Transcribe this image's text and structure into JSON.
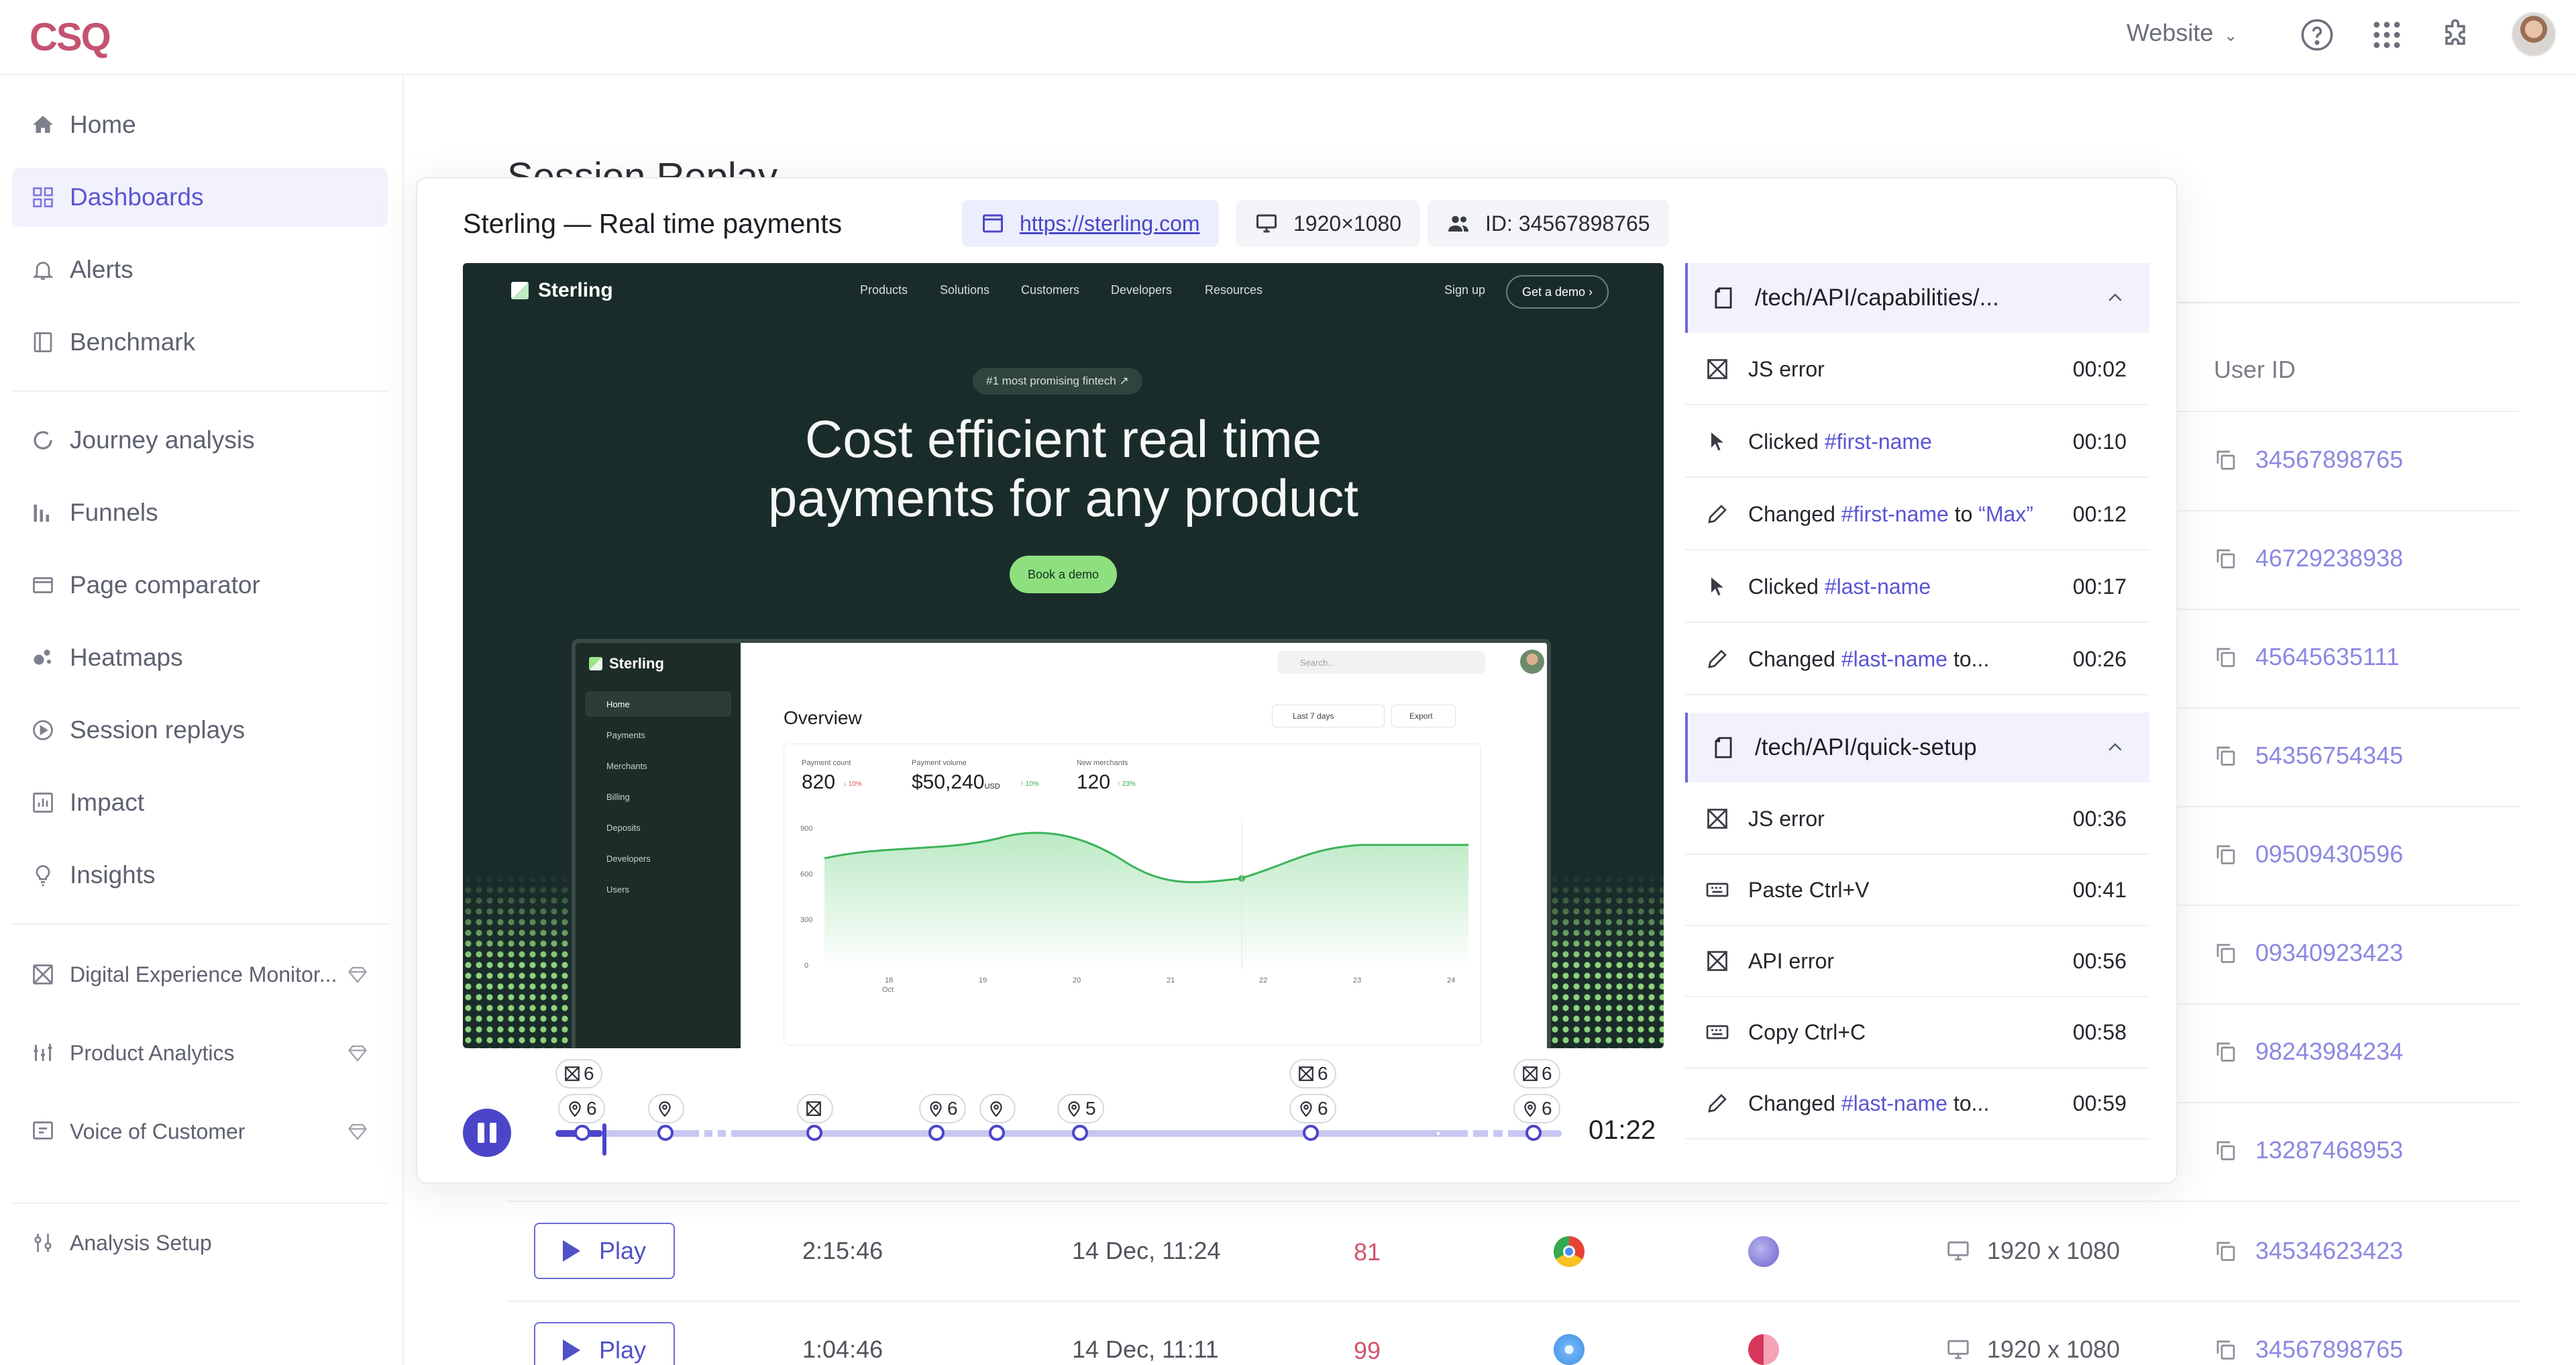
{
  "topbar": {
    "logo": "CSQ",
    "website_select": "Website"
  },
  "sidebar": {
    "items": [
      {
        "label": "Home",
        "icon": "home-icon"
      },
      {
        "label": "Dashboards",
        "icon": "grid-icon",
        "active": true
      },
      {
        "label": "Alerts",
        "icon": "bell-icon"
      },
      {
        "label": "Benchmark",
        "icon": "bookmark-icon"
      },
      {
        "label": "Journey analysis",
        "icon": "journey-icon"
      },
      {
        "label": "Funnels",
        "icon": "funnel-icon"
      },
      {
        "label": "Page comparator",
        "icon": "window-icon"
      },
      {
        "label": "Heatmaps",
        "icon": "heatmap-icon"
      },
      {
        "label": "Session replays",
        "icon": "play-circle-icon"
      },
      {
        "label": "Impact",
        "icon": "impact-icon"
      },
      {
        "label": "Insights",
        "icon": "lightbulb-icon"
      }
    ],
    "products": [
      {
        "label": "Digital Experience Monitor...",
        "icon": "monitor-icon"
      },
      {
        "label": "Product Analytics",
        "icon": "analytics-icon"
      },
      {
        "label": "Voice of Customer",
        "icon": "voice-icon"
      }
    ],
    "setup": {
      "label": "Analysis Setup",
      "icon": "sliders-icon"
    }
  },
  "background": {
    "page_title": "Session Replay",
    "column_user_id": "User ID",
    "user_ids": [
      "34567898765",
      "46729238938",
      "45645635111",
      "54356754345",
      "09509430596",
      "09340923423",
      "98243984234",
      "13287468953"
    ],
    "rows": [
      {
        "play": "Play",
        "duration": "2:15:46",
        "date": "14 Dec, 11:24",
        "score": "81",
        "browser": "chrome",
        "resolution": "1920 x 1080",
        "user_id": "34534623423"
      },
      {
        "play": "Play",
        "duration": "1:04:46",
        "date": "14 Dec, 11:11",
        "score": "99",
        "browser": "safari",
        "resolution": "1920 x 1080",
        "user_id": "34567898765"
      }
    ]
  },
  "modal": {
    "title": "Sterling — Real time payments",
    "url": "https://sterling.com",
    "resolution": "1920×1080",
    "id_label": "ID: 34567898765",
    "time_readout": "01:22"
  },
  "replay": {
    "brand": "Sterling",
    "nav": [
      "Products",
      "Solutions",
      "Customers",
      "Developers",
      "Resources"
    ],
    "signup": "Sign up",
    "get_demo": "Get a demo",
    "pill": "#1 most promising fintech ↗",
    "hero_line1": "Cost efficient real time",
    "hero_line2": "payments for any product",
    "cta": "Book a demo",
    "mock": {
      "brand": "Sterling",
      "menu": [
        "Home",
        "Payments",
        "Merchants",
        "Billing",
        "Deposits",
        "Developers",
        "Users"
      ],
      "search": "Search...",
      "overview": "Overview",
      "range": "Last 7 days",
      "export": "Export",
      "kpis": [
        {
          "label": "Payment count",
          "value": "820",
          "delta": "↓ 10%",
          "dir": "neg"
        },
        {
          "label": "Payment volume",
          "value": "$50,240",
          "unit": "USD",
          "delta": "↑ 10%",
          "dir": "pos"
        },
        {
          "label": "New merchants",
          "value": "120",
          "delta": "↑ 23%",
          "dir": "pos"
        }
      ],
      "y_ticks": [
        "900",
        "600",
        "300",
        "0"
      ],
      "x_ticks": [
        "18",
        "19",
        "20",
        "21",
        "22",
        "23",
        "24"
      ],
      "x_month": "Oct"
    }
  },
  "timeline_badges": [
    "6",
    "6",
    "6",
    "5",
    "6",
    "6",
    "6",
    "6"
  ],
  "events": {
    "group1": {
      "path": "/tech/API/capabilities/...",
      "rows": [
        {
          "icon": "error-icon",
          "text": "JS error",
          "time": "00:02"
        },
        {
          "icon": "cursor-icon",
          "pre": "Clicked ",
          "hl": "#first-name",
          "post": "",
          "time": "00:10"
        },
        {
          "icon": "pencil-icon",
          "pre": "Changed ",
          "hl": "#first-name",
          "post": " to ",
          "hl2": "“Max”",
          "time": "00:12"
        },
        {
          "icon": "cursor-icon",
          "pre": "Clicked ",
          "hl": "#last-name",
          "post": "",
          "time": "00:17"
        },
        {
          "icon": "pencil-icon",
          "pre": "Changed ",
          "hl": "#last-name",
          "post": " to...",
          "time": "00:26"
        }
      ]
    },
    "group2": {
      "path": "/tech/API/quick-setup",
      "rows": [
        {
          "icon": "error-icon",
          "text": "JS error",
          "time": "00:36"
        },
        {
          "icon": "keyboard-icon",
          "text": "Paste Ctrl+V",
          "time": "00:41"
        },
        {
          "icon": "error-icon",
          "text": "API error",
          "time": "00:56"
        },
        {
          "icon": "keyboard-icon",
          "text": "Copy Ctrl+C",
          "time": "00:58"
        },
        {
          "icon": "pencil-icon",
          "pre": "Changed ",
          "hl": "#last-name",
          "post": " to...",
          "time": "00:59"
        }
      ]
    }
  },
  "colors": {
    "accent": "#4b46c9",
    "accent_light": "#f1f2fb",
    "link": "#8b88e2",
    "score_red": "#d1546b",
    "video_bg": "#1a2c2a",
    "cta_green": "#8ee07f"
  }
}
